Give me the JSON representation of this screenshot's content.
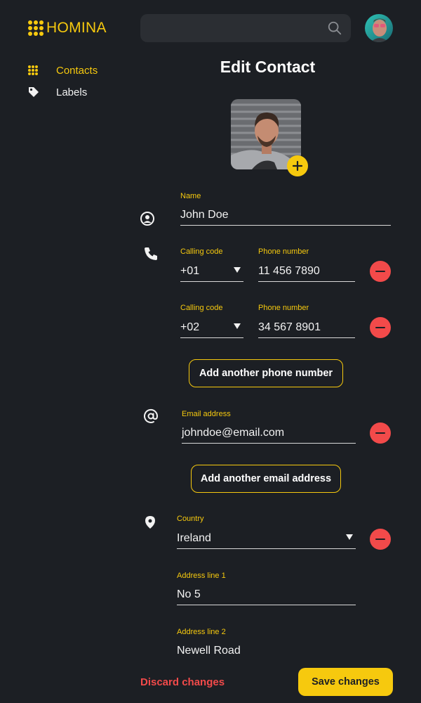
{
  "app": {
    "name": "HOMINA"
  },
  "search": {
    "placeholder": ""
  },
  "sidebar": {
    "items": [
      {
        "label": "Contacts",
        "icon": "grid-icon",
        "active": true
      },
      {
        "label": "Labels",
        "icon": "tag-icon",
        "active": false
      }
    ]
  },
  "page": {
    "title": "Edit Contact"
  },
  "form": {
    "name": {
      "label": "Name",
      "value": "John Doe"
    },
    "phones": [
      {
        "code_label": "Calling code",
        "code": "+01",
        "number_label": "Phone number",
        "number": "11 456 7890"
      },
      {
        "code_label": "Calling code",
        "code": "+02",
        "number_label": "Phone number",
        "number": "34 567 8901"
      }
    ],
    "add_phone_label": "Add another phone number",
    "email": {
      "label": "Email address",
      "value": "johndoe@email.com"
    },
    "add_email_label": "Add another email address",
    "address": {
      "country_label": "Country",
      "country": "Ireland",
      "line1_label": "Address line 1",
      "line1": "No 5",
      "line2_label": "Address line 2",
      "line2": "Newell Road"
    }
  },
  "actions": {
    "discard_label": "Discard changes",
    "save_label": "Save changes"
  },
  "colors": {
    "accent": "#f6c90e",
    "danger": "#f24a4a",
    "background": "#1c1f24",
    "input_bg": "#2b2e33"
  }
}
